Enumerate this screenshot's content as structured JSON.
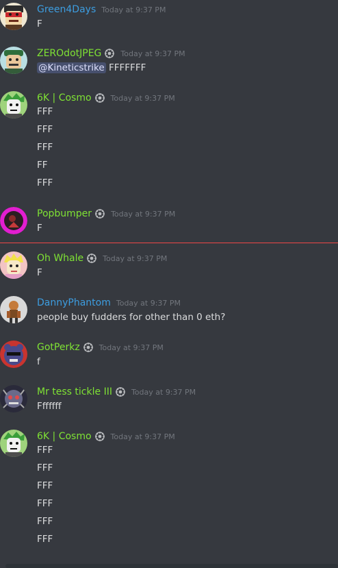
{
  "colors": {
    "background": "#36393f",
    "message_text": "#dcddde",
    "timestamp": "#72767d",
    "username_blue": "#3d9de0",
    "username_green": "#7fe234",
    "new_messages_divider": "#f04747"
  },
  "messages": [
    {
      "username": "Green4Days",
      "username_color": "#3d9de0",
      "badge": false,
      "timestamp": "Today at 9:37 PM",
      "avatar": "red-bandana-avatar",
      "lines": [
        "F"
      ]
    },
    {
      "username": "ZEROdotJPEG",
      "username_color": "#7fe234",
      "badge": true,
      "timestamp": "Today at 9:37 PM",
      "avatar": "green-cap-avatar",
      "mention": "@Kineticstrike",
      "lines": [
        "FFFFFFF"
      ]
    },
    {
      "username": "6K | Cosmo",
      "username_color": "#7fe234",
      "badge": true,
      "timestamp": "Today at 9:37 PM",
      "avatar": "green-hair-avatar",
      "lines": [
        "FFF",
        "FFF",
        "FFF",
        "FF",
        "FFF"
      ]
    },
    {
      "username": "Popbumper",
      "username_color": "#7fe234",
      "badge": true,
      "timestamp": "Today at 9:37 PM",
      "avatar": "magenta-ring-avatar",
      "lines": [
        "F"
      ]
    },
    {
      "username": "Oh Whale",
      "username_color": "#7fe234",
      "badge": true,
      "timestamp": "Today at 9:37 PM",
      "avatar": "blonde-avatar",
      "lines": [
        "F"
      ]
    },
    {
      "username": "DannyPhantom",
      "username_color": "#3d9de0",
      "badge": false,
      "timestamp": "Today at 9:37 PM",
      "avatar": "cartoon-figure-avatar",
      "lines": [
        "people buy fudders for other than 0 eth?"
      ]
    },
    {
      "username": "GotPerkz",
      "username_color": "#7fe234",
      "badge": true,
      "timestamp": "Today at 9:37 PM",
      "avatar": "red-bear-avatar",
      "lines": [
        "f"
      ]
    },
    {
      "username": "Mr tess tickle III",
      "username_color": "#7fe234",
      "badge": true,
      "timestamp": "Today at 9:37 PM",
      "avatar": "robot-avatar",
      "lines": [
        "Fffffff"
      ]
    },
    {
      "username": "6K | Cosmo",
      "username_color": "#7fe234",
      "badge": true,
      "timestamp": "Today at 9:37 PM",
      "avatar": "green-hair-avatar",
      "lines": [
        "FFF",
        "FFF",
        "FFF",
        "FFF",
        "FFF",
        "FFF"
      ]
    }
  ]
}
